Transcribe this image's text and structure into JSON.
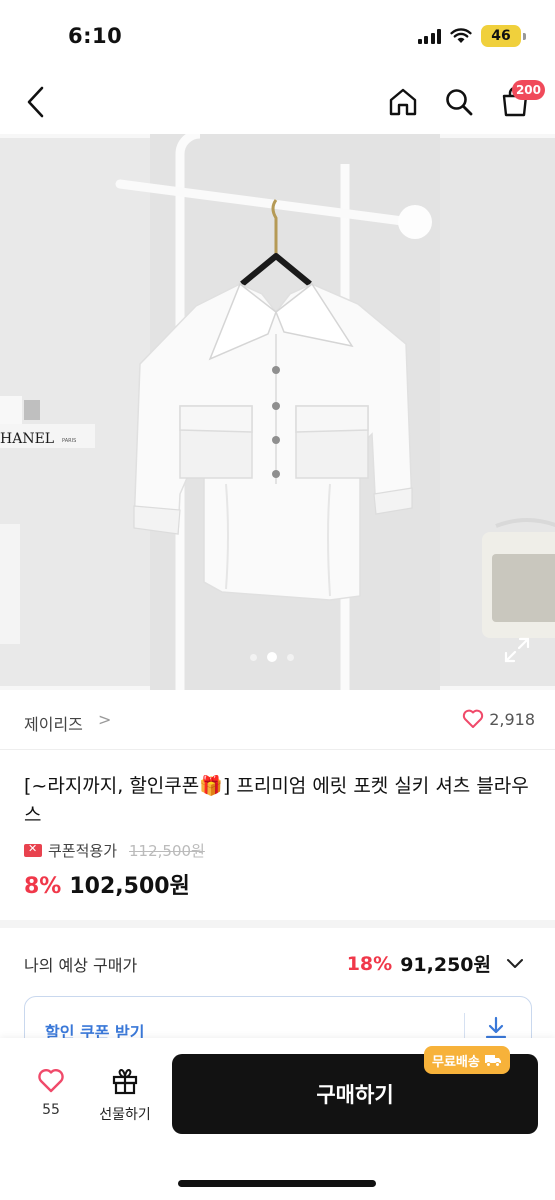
{
  "status_bar": {
    "time": "6:10",
    "battery": "46"
  },
  "nav": {
    "cart_badge": "200"
  },
  "gallery": {
    "current_index": 1,
    "total": 3
  },
  "seller": {
    "name": "제이리즈",
    "chevron": ">",
    "likes": "2,918"
  },
  "product": {
    "title": "[~라지까지, 할인쿠폰🎁] 프리미엄 에릿 포켓 실키 셔츠 블라우스",
    "coupon_label": "쿠폰적용가",
    "original_price": "112,500원",
    "discount": "8%",
    "price": "102,500원"
  },
  "expected": {
    "label": "나의 예상 구매가",
    "discount": "18%",
    "price": "91,250원"
  },
  "coupon_box": {
    "text": "할인 쿠폰 받기"
  },
  "bottom": {
    "like_count": "55",
    "gift_label": "선물하기",
    "buy_label": "구매하기",
    "free_shipping": "무료배송"
  },
  "colors": {
    "accent_red": "#f0384a",
    "badge_red": "#f04a5a",
    "coupon_blue": "#3a78d8",
    "free_ship_orange": "#f7b23a",
    "battery_yellow": "#f0d03c"
  }
}
